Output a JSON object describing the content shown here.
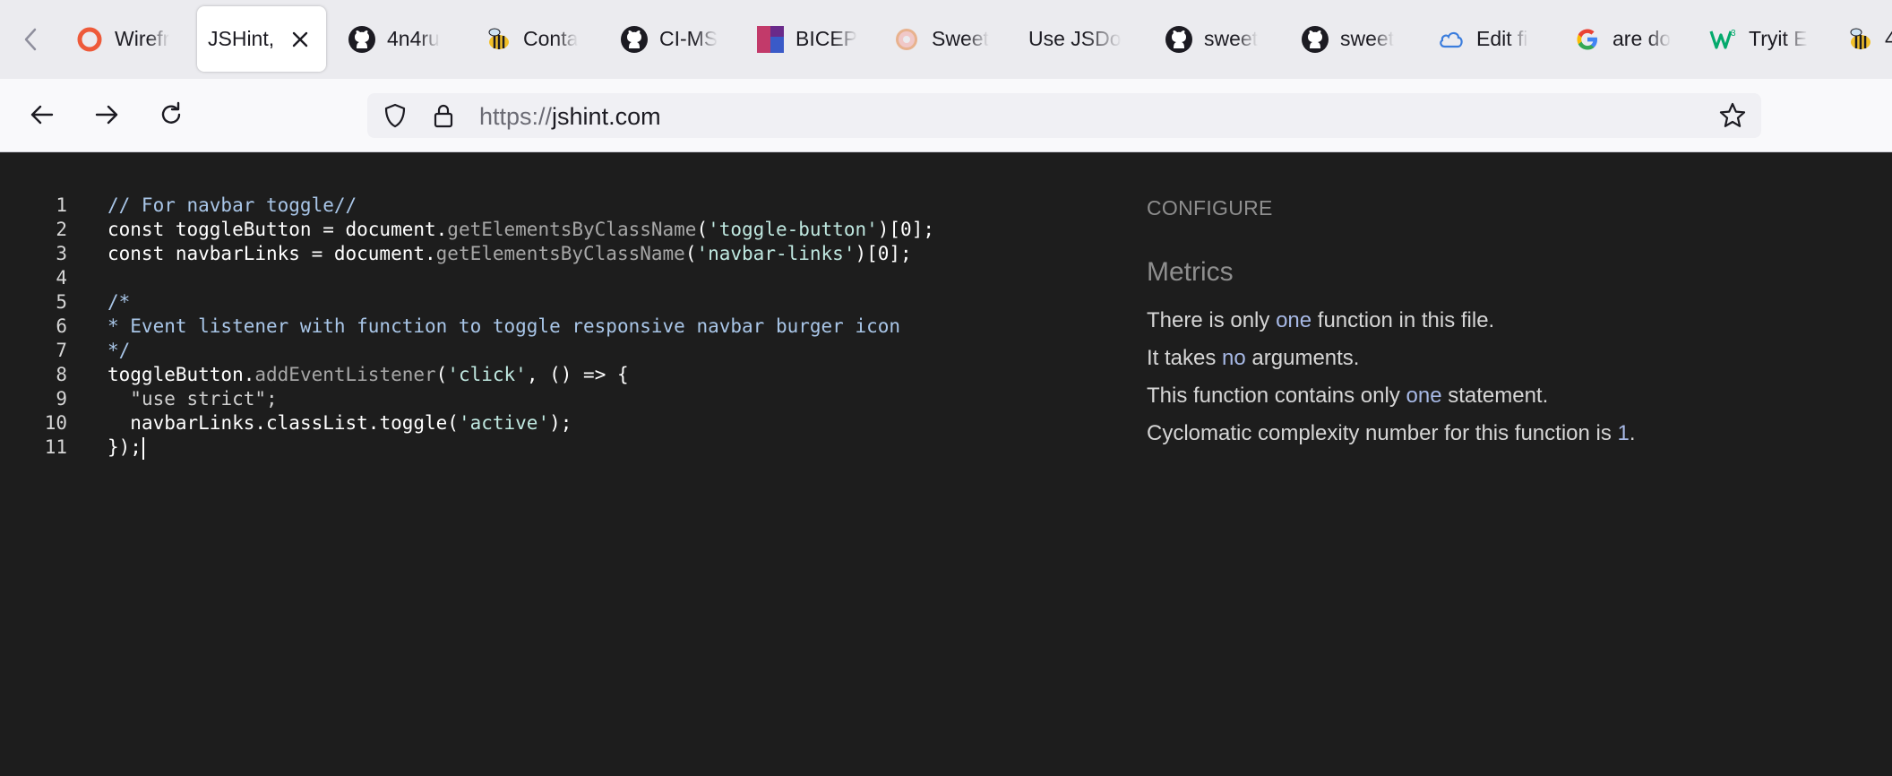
{
  "browser": {
    "tabs": [
      {
        "label": "Wirefr",
        "icon": "opera-ring-icon"
      },
      {
        "label": "JSHint,",
        "icon": "",
        "active": true
      },
      {
        "label": "4n4ru",
        "icon": "github-icon"
      },
      {
        "label": "Conta",
        "icon": "bee-icon"
      },
      {
        "label": "CI-MS",
        "icon": "github-icon"
      },
      {
        "label": "BICEP",
        "icon": "image-thumbnail-icon"
      },
      {
        "label": "Sweet",
        "icon": "donut-icon"
      },
      {
        "label": "Use JSDo",
        "icon": ""
      },
      {
        "label": "sweet",
        "icon": "github-icon"
      },
      {
        "label": "sweet",
        "icon": "github-icon"
      },
      {
        "label": "Edit fi",
        "icon": "cloud-icon"
      },
      {
        "label": "are do",
        "icon": "google-g-icon"
      },
      {
        "label": "Tryit E",
        "icon": "w3schools-icon"
      },
      {
        "label": "4",
        "icon": "bee-icon"
      }
    ],
    "url_scheme": "https://",
    "url_host": "jshint.com"
  },
  "editor": {
    "line_numbers": [
      "1",
      "2",
      "3",
      "4",
      "5",
      "6",
      "7",
      "8",
      "9",
      "10",
      "11"
    ],
    "lines": {
      "l1": {
        "comment": "// For navbar toggle//"
      },
      "l2": {
        "kw": "const",
        "a": " toggleButton = document.",
        "method": "getElementsByClassName",
        "b": "(",
        "str": "'toggle-button'",
        "c": ")[0];"
      },
      "l3": {
        "kw": "const",
        "a": " navbarLinks = document.",
        "method": "getElementsByClassName",
        "b": "(",
        "str": "'navbar-links'",
        "c": ")[0];"
      },
      "l5": {
        "comment": "/*"
      },
      "l6": {
        "comment": "* Event listener with function to toggle responsive navbar burger icon"
      },
      "l7": {
        "comment": "*/"
      },
      "l8": {
        "a": "toggleButton.",
        "method": "addEventListener",
        "b": "(",
        "str": "'click'",
        "c": ", () => {"
      },
      "l9": {
        "indent": "  ",
        "dim": "\"use strict\";"
      },
      "l10": {
        "indent": "  ",
        "a": "navbarLinks.classList.toggle(",
        "str": "'active'",
        "c": ");"
      },
      "l11": {
        "a": "});"
      }
    }
  },
  "sidebar": {
    "configure_label": "CONFIGURE",
    "metrics_title": "Metrics",
    "m1": {
      "pre": "There is only ",
      "hl": "one",
      "post": " function in this file."
    },
    "m2": {
      "pre": "It takes ",
      "hl": "no",
      "post": " arguments."
    },
    "m3": {
      "pre": "This function contains only ",
      "hl": "one",
      "post": " statement."
    },
    "m4": {
      "pre": "Cyclomatic complexity number for this function is ",
      "hl": "1",
      "post": "."
    }
  },
  "colors": {
    "page_bg": "#1d1d1d",
    "comment": "#a9c6e8",
    "string": "#bfe8e0",
    "highlight": "#a7b9e6"
  }
}
